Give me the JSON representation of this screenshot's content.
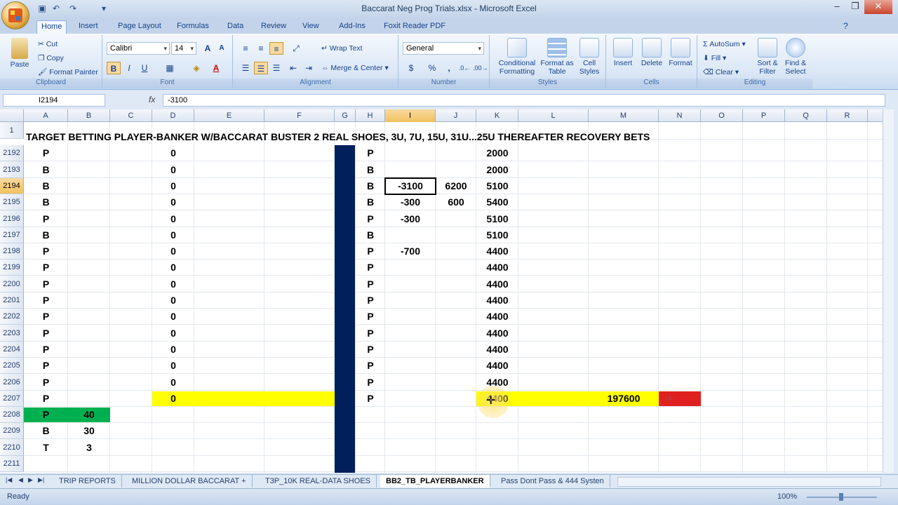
{
  "window": {
    "title": "Baccarat Neg Prog Trials.xlsx - Microsoft Excel"
  },
  "ribbon_tabs": [
    "Home",
    "Insert",
    "Page Layout",
    "Formulas",
    "Data",
    "Review",
    "View",
    "Add-Ins",
    "Foxit Reader PDF"
  ],
  "clipboard": {
    "paste": "Paste",
    "cut": "Cut",
    "copy": "Copy",
    "format_painter": "Format Painter",
    "label": "Clipboard"
  },
  "font": {
    "name": "Calibri",
    "size": "14",
    "label": "Font",
    "bold": "B",
    "italic": "I",
    "underline": "U"
  },
  "alignment": {
    "wrap": "Wrap Text",
    "merge": "Merge & Center",
    "label": "Alignment"
  },
  "number": {
    "format": "General",
    "label": "Number",
    "currency": "$",
    "percent": "%",
    "comma": ","
  },
  "styles": {
    "conditional": "Conditional Formatting",
    "format_table": "Format as Table",
    "cell_styles": "Cell Styles",
    "label": "Styles"
  },
  "cells": {
    "insert": "Insert",
    "delete": "Delete",
    "format": "Format",
    "label": "Cells"
  },
  "editing": {
    "autosum": "AutoSum",
    "fill": "Fill",
    "clear": "Clear",
    "sort": "Sort & Filter",
    "find": "Find & Select",
    "label": "Editing"
  },
  "formula_bar": {
    "name_box": "I2194",
    "fx": "fx",
    "value": "-3100"
  },
  "columns": [
    "A",
    "B",
    "C",
    "D",
    "E",
    "F",
    "G",
    "H",
    "I",
    "J",
    "K",
    "L",
    "M",
    "N",
    "O",
    "P",
    "Q",
    "R"
  ],
  "selected_column": "I",
  "title_row": {
    "row": "1",
    "text": "TARGET BETTING PLAYER-BANKER W/BACCARAT BUSTER 2 REAL SHOES, 3U, 7U, 15U, 31U...25U THEREAFTER RECOVERY BETS"
  },
  "rows": [
    {
      "n": "2192",
      "a": "P",
      "b": "",
      "d": "0",
      "h": "P",
      "i": "",
      "j": "",
      "k": "2000"
    },
    {
      "n": "2193",
      "a": "B",
      "b": "",
      "d": "0",
      "h": "B",
      "i": "",
      "j": "",
      "k": "2000"
    },
    {
      "n": "2194",
      "a": "B",
      "b": "",
      "d": "0",
      "h": "B",
      "i": "-3100",
      "j": "6200",
      "k": "5100"
    },
    {
      "n": "2195",
      "a": "B",
      "b": "",
      "d": "0",
      "h": "B",
      "i": "-300",
      "j": "600",
      "k": "5400"
    },
    {
      "n": "2196",
      "a": "P",
      "b": "",
      "d": "0",
      "h": "P",
      "i": "-300",
      "j": "",
      "k": "5100"
    },
    {
      "n": "2197",
      "a": "B",
      "b": "",
      "d": "0",
      "h": "B",
      "i": "",
      "j": "",
      "k": "5100"
    },
    {
      "n": "2198",
      "a": "P",
      "b": "",
      "d": "0",
      "h": "P",
      "i": "-700",
      "j": "",
      "k": "4400"
    },
    {
      "n": "2199",
      "a": "P",
      "b": "",
      "d": "0",
      "h": "P",
      "i": "",
      "j": "",
      "k": "4400"
    },
    {
      "n": "2200",
      "a": "P",
      "b": "",
      "d": "0",
      "h": "P",
      "i": "",
      "j": "",
      "k": "4400"
    },
    {
      "n": "2201",
      "a": "P",
      "b": "",
      "d": "0",
      "h": "P",
      "i": "",
      "j": "",
      "k": "4400"
    },
    {
      "n": "2202",
      "a": "P",
      "b": "",
      "d": "0",
      "h": "P",
      "i": "",
      "j": "",
      "k": "4400"
    },
    {
      "n": "2203",
      "a": "P",
      "b": "",
      "d": "0",
      "h": "P",
      "i": "",
      "j": "",
      "k": "4400"
    },
    {
      "n": "2204",
      "a": "P",
      "b": "",
      "d": "0",
      "h": "P",
      "i": "",
      "j": "",
      "k": "4400"
    },
    {
      "n": "2205",
      "a": "P",
      "b": "",
      "d": "0",
      "h": "P",
      "i": "",
      "j": "",
      "k": "4400"
    },
    {
      "n": "2206",
      "a": "P",
      "b": "",
      "d": "0",
      "h": "P",
      "i": "",
      "j": "",
      "k": "4400"
    },
    {
      "n": "2207",
      "a": "P",
      "b": "",
      "d": "0",
      "h": "P",
      "i": "",
      "j": "",
      "k": "4400",
      "m": "197600",
      "n_cell": "ok"
    },
    {
      "n": "2208",
      "a": "P",
      "b": "40",
      "d": "",
      "h": "",
      "i": "",
      "j": "",
      "k": ""
    },
    {
      "n": "2209",
      "a": "B",
      "b": "30",
      "d": "",
      "h": "",
      "i": "",
      "j": "",
      "k": ""
    },
    {
      "n": "2210",
      "a": "T",
      "b": "3",
      "d": "",
      "h": "",
      "i": "",
      "j": "",
      "k": ""
    },
    {
      "n": "2211",
      "a": "",
      "b": "",
      "d": "",
      "h": "",
      "i": "",
      "j": "",
      "k": ""
    }
  ],
  "sheet_tabs": [
    "TRIP REPORTS",
    "MILLION DOLLAR BACCARAT +",
    "T3P_10K REAL-DATA SHOES",
    "BB2_TB_PLAYERBANKER",
    "Pass Dont Pass & 444 Systen"
  ],
  "active_sheet": "BB2_TB_PLAYERBANKER",
  "status": {
    "text": "Ready",
    "zoom": "100%"
  },
  "colors": {
    "highlight_yellow": "#ffff00",
    "green": "#00b050",
    "red": "#e02020",
    "navy": "#001f5b"
  }
}
